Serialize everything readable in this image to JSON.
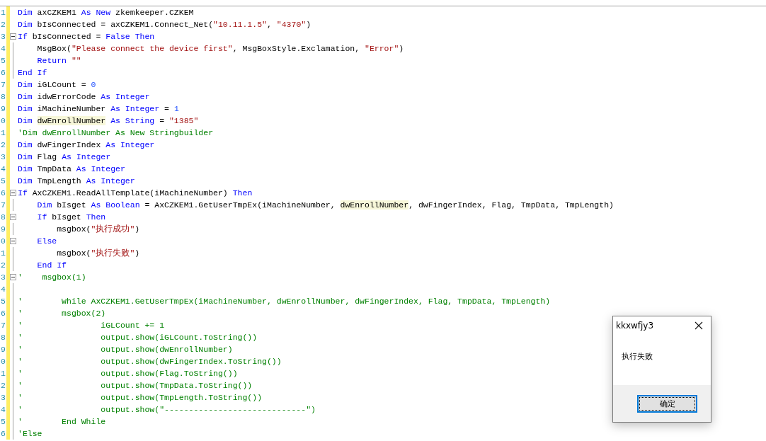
{
  "editor": {
    "lines": [
      {
        "number": "1",
        "collapsible": false,
        "in_block": false,
        "tokens": [
          {
            "kind": "keyword",
            "text": "Dim"
          },
          {
            "kind": "plain",
            "text": " axCZKEM1 "
          },
          {
            "kind": "keyword",
            "text": "As New"
          },
          {
            "kind": "plain",
            "text": " zkemkeeper.CZKEM"
          }
        ]
      },
      {
        "number": "2",
        "collapsible": false,
        "in_block": false,
        "tokens": [
          {
            "kind": "keyword",
            "text": "Dim"
          },
          {
            "kind": "plain",
            "text": " bIsConnected = axCZKEM1.Connect_Net("
          },
          {
            "kind": "string",
            "text": "\"10.11.1.5\""
          },
          {
            "kind": "plain",
            "text": ", "
          },
          {
            "kind": "string",
            "text": "\"4370\""
          },
          {
            "kind": "plain",
            "text": ")"
          }
        ]
      },
      {
        "number": "3",
        "collapsible": true,
        "in_block": false,
        "tokens": [
          {
            "kind": "keyword",
            "text": "If"
          },
          {
            "kind": "plain",
            "text": " bIsConnected = "
          },
          {
            "kind": "keyword",
            "text": "False Then"
          }
        ]
      },
      {
        "number": "4",
        "collapsible": false,
        "in_block": true,
        "tokens": [
          {
            "kind": "plain",
            "text": "    MsgBox("
          },
          {
            "kind": "string",
            "text": "\"Please connect the device first\""
          },
          {
            "kind": "plain",
            "text": ", MsgBoxStyle.Exclamation, "
          },
          {
            "kind": "string",
            "text": "\"Error\""
          },
          {
            "kind": "plain",
            "text": ")"
          }
        ]
      },
      {
        "number": "5",
        "collapsible": false,
        "in_block": true,
        "tokens": [
          {
            "kind": "keyword",
            "text": "    Return"
          },
          {
            "kind": "string",
            "text": " \"\""
          }
        ]
      },
      {
        "number": "6",
        "collapsible": false,
        "in_block": true,
        "tokens": [
          {
            "kind": "keyword",
            "text": "End If"
          }
        ]
      },
      {
        "number": "7",
        "collapsible": false,
        "in_block": false,
        "tokens": [
          {
            "kind": "keyword",
            "text": "Dim"
          },
          {
            "kind": "plain",
            "text": " iGLCount = "
          },
          {
            "kind": "number",
            "text": "0"
          }
        ]
      },
      {
        "number": "8",
        "collapsible": false,
        "in_block": false,
        "tokens": [
          {
            "kind": "keyword",
            "text": "Dim"
          },
          {
            "kind": "plain",
            "text": " idwErrorCode "
          },
          {
            "kind": "keyword",
            "text": "As Integer"
          }
        ]
      },
      {
        "number": "9",
        "collapsible": false,
        "in_block": false,
        "tokens": [
          {
            "kind": "keyword",
            "text": "Dim"
          },
          {
            "kind": "plain",
            "text": " iMachineNumber "
          },
          {
            "kind": "keyword",
            "text": "As Integer"
          },
          {
            "kind": "plain",
            "text": " = "
          },
          {
            "kind": "number",
            "text": "1"
          }
        ]
      },
      {
        "number": "0",
        "collapsible": false,
        "in_block": false,
        "tokens": [
          {
            "kind": "keyword",
            "text": "Dim "
          },
          {
            "kind": "highlight",
            "text": "dwEnrollNumber"
          },
          {
            "kind": "keyword",
            "text": " As String"
          },
          {
            "kind": "plain",
            "text": " = "
          },
          {
            "kind": "string",
            "text": "\"1385\""
          }
        ]
      },
      {
        "number": "1",
        "collapsible": false,
        "in_block": false,
        "tokens": [
          {
            "kind": "comment",
            "text": "'Dim dwEnrollNumber As New Stringbuilder"
          }
        ]
      },
      {
        "number": "2",
        "collapsible": false,
        "in_block": false,
        "tokens": [
          {
            "kind": "keyword",
            "text": "Dim"
          },
          {
            "kind": "plain",
            "text": " dwFingerIndex "
          },
          {
            "kind": "keyword",
            "text": "As Integer"
          }
        ]
      },
      {
        "number": "3",
        "collapsible": false,
        "in_block": false,
        "tokens": [
          {
            "kind": "keyword",
            "text": "Dim"
          },
          {
            "kind": "plain",
            "text": " Flag "
          },
          {
            "kind": "keyword",
            "text": "As Integer"
          }
        ]
      },
      {
        "number": "4",
        "collapsible": false,
        "in_block": false,
        "tokens": [
          {
            "kind": "keyword",
            "text": "Dim"
          },
          {
            "kind": "plain",
            "text": " TmpData "
          },
          {
            "kind": "keyword",
            "text": "As Integer"
          }
        ]
      },
      {
        "number": "5",
        "collapsible": false,
        "in_block": false,
        "tokens": [
          {
            "kind": "keyword",
            "text": "Dim"
          },
          {
            "kind": "plain",
            "text": " TmpLength "
          },
          {
            "kind": "keyword",
            "text": "As Integer"
          }
        ]
      },
      {
        "number": "6",
        "collapsible": true,
        "in_block": false,
        "tokens": [
          {
            "kind": "keyword",
            "text": "If"
          },
          {
            "kind": "plain",
            "text": " AxCZKEM1.ReadAllTemplate(iMachineNumber) "
          },
          {
            "kind": "keyword",
            "text": "Then"
          }
        ]
      },
      {
        "number": "7",
        "collapsible": false,
        "in_block": true,
        "tokens": [
          {
            "kind": "keyword",
            "text": "    Dim"
          },
          {
            "kind": "plain",
            "text": " bIsget "
          },
          {
            "kind": "keyword",
            "text": "As Boolean"
          },
          {
            "kind": "plain",
            "text": " = AxCZKEM1.GetUserTmpEx(iMachineNumber, "
          },
          {
            "kind": "highlight",
            "text": "dwEnrollNumber"
          },
          {
            "kind": "plain",
            "text": ", dwFingerIndex, Flag, TmpData, TmpLength)"
          }
        ]
      },
      {
        "number": "8",
        "collapsible": true,
        "in_block": false,
        "tokens": [
          {
            "kind": "keyword",
            "text": "    If"
          },
          {
            "kind": "plain",
            "text": " bIsget "
          },
          {
            "kind": "keyword",
            "text": "Then"
          }
        ]
      },
      {
        "number": "9",
        "collapsible": false,
        "in_block": true,
        "tokens": [
          {
            "kind": "plain",
            "text": "        msgbox("
          },
          {
            "kind": "string",
            "text": "\"执行成功\""
          },
          {
            "kind": "plain",
            "text": ")"
          }
        ]
      },
      {
        "number": "0",
        "collapsible": true,
        "in_block": false,
        "tokens": [
          {
            "kind": "keyword",
            "text": "    Else"
          }
        ]
      },
      {
        "number": "1",
        "collapsible": false,
        "in_block": true,
        "tokens": [
          {
            "kind": "plain",
            "text": "        msgbox("
          },
          {
            "kind": "string",
            "text": "\"执行失败\""
          },
          {
            "kind": "plain",
            "text": ")"
          }
        ]
      },
      {
        "number": "2",
        "collapsible": false,
        "in_block": true,
        "tokens": [
          {
            "kind": "keyword",
            "text": "    End If"
          }
        ]
      },
      {
        "number": "3",
        "collapsible": true,
        "in_block": false,
        "tokens": [
          {
            "kind": "comment",
            "text": "'    msgbox(1)"
          }
        ]
      },
      {
        "number": "4",
        "collapsible": false,
        "in_block": true
      },
      {
        "number": "5",
        "collapsible": false,
        "in_block": true,
        "tokens": [
          {
            "kind": "comment",
            "text": "'        While AxCZKEM1.GetUserTmpEx(iMachineNumber, dwEnrollNumber, dwFingerIndex, Flag, TmpData, TmpLength)"
          }
        ]
      },
      {
        "number": "6",
        "collapsible": false,
        "in_block": true,
        "tokens": [
          {
            "kind": "comment",
            "text": "'        msgbox(2)"
          }
        ]
      },
      {
        "number": "7",
        "collapsible": false,
        "in_block": true,
        "tokens": [
          {
            "kind": "comment",
            "text": "'                iGLCount += 1"
          }
        ]
      },
      {
        "number": "8",
        "collapsible": false,
        "in_block": true,
        "tokens": [
          {
            "kind": "comment",
            "text": "'                output.show(iGLCount.ToString())"
          }
        ]
      },
      {
        "number": "9",
        "collapsible": false,
        "in_block": true,
        "tokens": [
          {
            "kind": "comment",
            "text": "'                output.show(dwEnrollNumber)"
          }
        ]
      },
      {
        "number": "0",
        "collapsible": false,
        "in_block": true,
        "tokens": [
          {
            "kind": "comment",
            "text": "'                output.show(dwFingerIndex.ToString())"
          }
        ]
      },
      {
        "number": "1",
        "collapsible": false,
        "in_block": true,
        "tokens": [
          {
            "kind": "comment",
            "text": "'                output.show(Flag.ToString())"
          }
        ]
      },
      {
        "number": "2",
        "collapsible": false,
        "in_block": true,
        "tokens": [
          {
            "kind": "comment",
            "text": "'                output.show(TmpData.ToString())"
          }
        ]
      },
      {
        "number": "3",
        "collapsible": false,
        "in_block": true,
        "tokens": [
          {
            "kind": "comment",
            "text": "'                output.show(TmpLength.ToString())"
          }
        ]
      },
      {
        "number": "4",
        "collapsible": false,
        "in_block": true,
        "tokens": [
          {
            "kind": "comment",
            "text": "'                output.show(\"-----------------------------\")"
          }
        ]
      },
      {
        "number": "5",
        "collapsible": false,
        "in_block": true,
        "tokens": [
          {
            "kind": "comment",
            "text": "'        End While"
          }
        ]
      },
      {
        "number": "6",
        "collapsible": false,
        "in_block": true,
        "tokens": [
          {
            "kind": "comment",
            "text": "'Else"
          }
        ]
      }
    ]
  },
  "dialog": {
    "title": "kkxwfjy3",
    "message": "执行失败",
    "buttons": [
      {
        "label": "确定",
        "focused": true
      }
    ]
  }
}
